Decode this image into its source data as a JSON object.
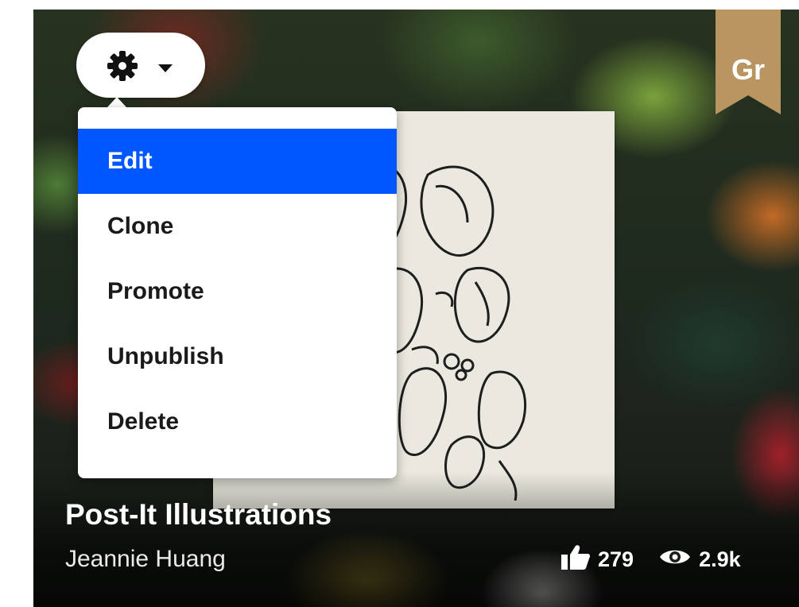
{
  "card": {
    "badge_text": "Gr",
    "title": "Post-It Illustrations",
    "author": "Jeannie Huang",
    "likes": "279",
    "views": "2.9k"
  },
  "settings": {
    "icon": "gear-icon",
    "caret_icon": "caret-down-icon"
  },
  "menu": {
    "items": [
      {
        "label": "Edit",
        "active": true
      },
      {
        "label": "Clone",
        "active": false
      },
      {
        "label": "Promote",
        "active": false
      },
      {
        "label": "Unpublish",
        "active": false
      },
      {
        "label": "Delete",
        "active": false
      }
    ]
  },
  "colors": {
    "menu_highlight": "#0057ff",
    "ribbon": "#b89561"
  }
}
